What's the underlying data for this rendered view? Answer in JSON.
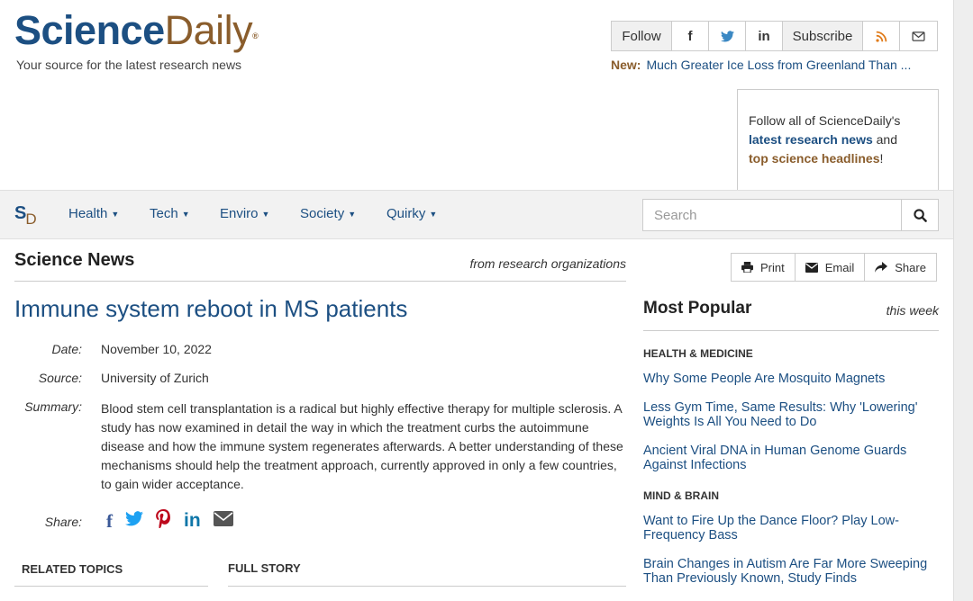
{
  "brand": {
    "name_part1": "Science",
    "name_part2": "Daily",
    "reg": "®",
    "tagline": "Your source for the latest research news"
  },
  "social": {
    "follow_label": "Follow",
    "facebook": "f",
    "linkedin": "in",
    "subscribe_label": "Subscribe"
  },
  "news_ticker": {
    "label": "New:",
    "text": "Much Greater Ice Loss from Greenland Than ..."
  },
  "followbox": {
    "line1": "Follow all of ScienceDaily's",
    "link1": "latest research news",
    "and": " and",
    "link2": "top science headlines",
    "end": "!"
  },
  "nav": {
    "logo_s": "S",
    "logo_d": "D",
    "items": [
      {
        "label": "Health"
      },
      {
        "label": "Tech"
      },
      {
        "label": "Enviro"
      },
      {
        "label": "Society"
      },
      {
        "label": "Quirky"
      }
    ],
    "search_placeholder": "Search"
  },
  "section": {
    "title": "Science News",
    "subtitle": "from research organizations"
  },
  "article": {
    "headline": "Immune system reboot in MS patients",
    "date_label": "Date:",
    "date": "November 10, 2022",
    "source_label": "Source:",
    "source": "University of Zurich",
    "summary_label": "Summary:",
    "summary": "Blood stem cell transplantation is a radical but highly effective therapy for multiple sclerosis. A study has now examined in detail the way in which the treatment curbs the autoimmune disease and how the immune system regenerates afterwards. A better understanding of these mechanisms should help the treatment approach, currently approved in only a few countries, to gain wider acceptance.",
    "share_label": "Share:",
    "related_topics": "RELATED TOPICS",
    "full_story": "FULL STORY"
  },
  "tools": {
    "print": "Print",
    "email": "Email",
    "share": "Share"
  },
  "most_popular": {
    "title": "Most Popular",
    "period": "this week",
    "categories": [
      {
        "name": "HEALTH & MEDICINE",
        "items": [
          "Why Some People Are Mosquito Magnets",
          "Less Gym Time, Same Results: Why 'Lowering' Weights Is All You Need to Do",
          "Ancient Viral DNA in Human Genome Guards Against Infections"
        ]
      },
      {
        "name": "MIND & BRAIN",
        "items": [
          "Want to Fire Up the Dance Floor? Play Low-Frequency Bass",
          "Brain Changes in Autism Are Far More Sweeping Than Previously Known, Study Finds"
        ]
      }
    ]
  },
  "colors": {
    "brand_blue": "#1c4f82",
    "brand_brown": "#8a5d2c"
  }
}
